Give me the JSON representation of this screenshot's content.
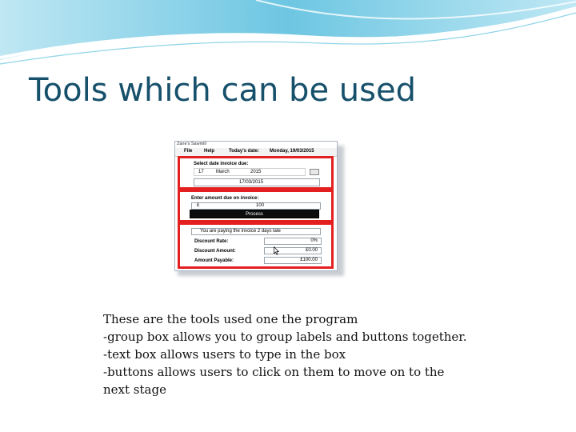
{
  "slide": {
    "title": "Tools which can be used",
    "body_lines": [
      "These are the tools used one the program",
      "-group box allows  you to group labels and buttons together.",
      "-text box allows users to type in the box",
      "-buttons allows users to click on them to move on to the",
      "next stage"
    ]
  },
  "app": {
    "window_title": "Zane's Sawmill",
    "menu": {
      "file": "File",
      "help": "Help",
      "today_label": "Today's date:",
      "today_value": "Monday, 19/03/2015"
    },
    "due_group": {
      "label": "Select date invoice due:",
      "day": "17",
      "month": "March",
      "year": "2015",
      "date_text": "17/03/2015"
    },
    "amount_group": {
      "label": "Enter amount due on invoice:",
      "currency": "£",
      "amount": "100",
      "process_label": "Process"
    },
    "result_group": {
      "message": "You are paying the invoice 2 days late",
      "discount_rate_label": "Discount Rate:",
      "discount_rate_value": "0%",
      "discount_amount_label": "Discount Amount:",
      "discount_amount_value": "£0.00",
      "amount_payable_label": "Amount Payable:",
      "amount_payable_value": "£100.00"
    }
  },
  "colors": {
    "title": "#17506b",
    "group_border": "#e3201f",
    "wave": "#4fb8d8"
  }
}
